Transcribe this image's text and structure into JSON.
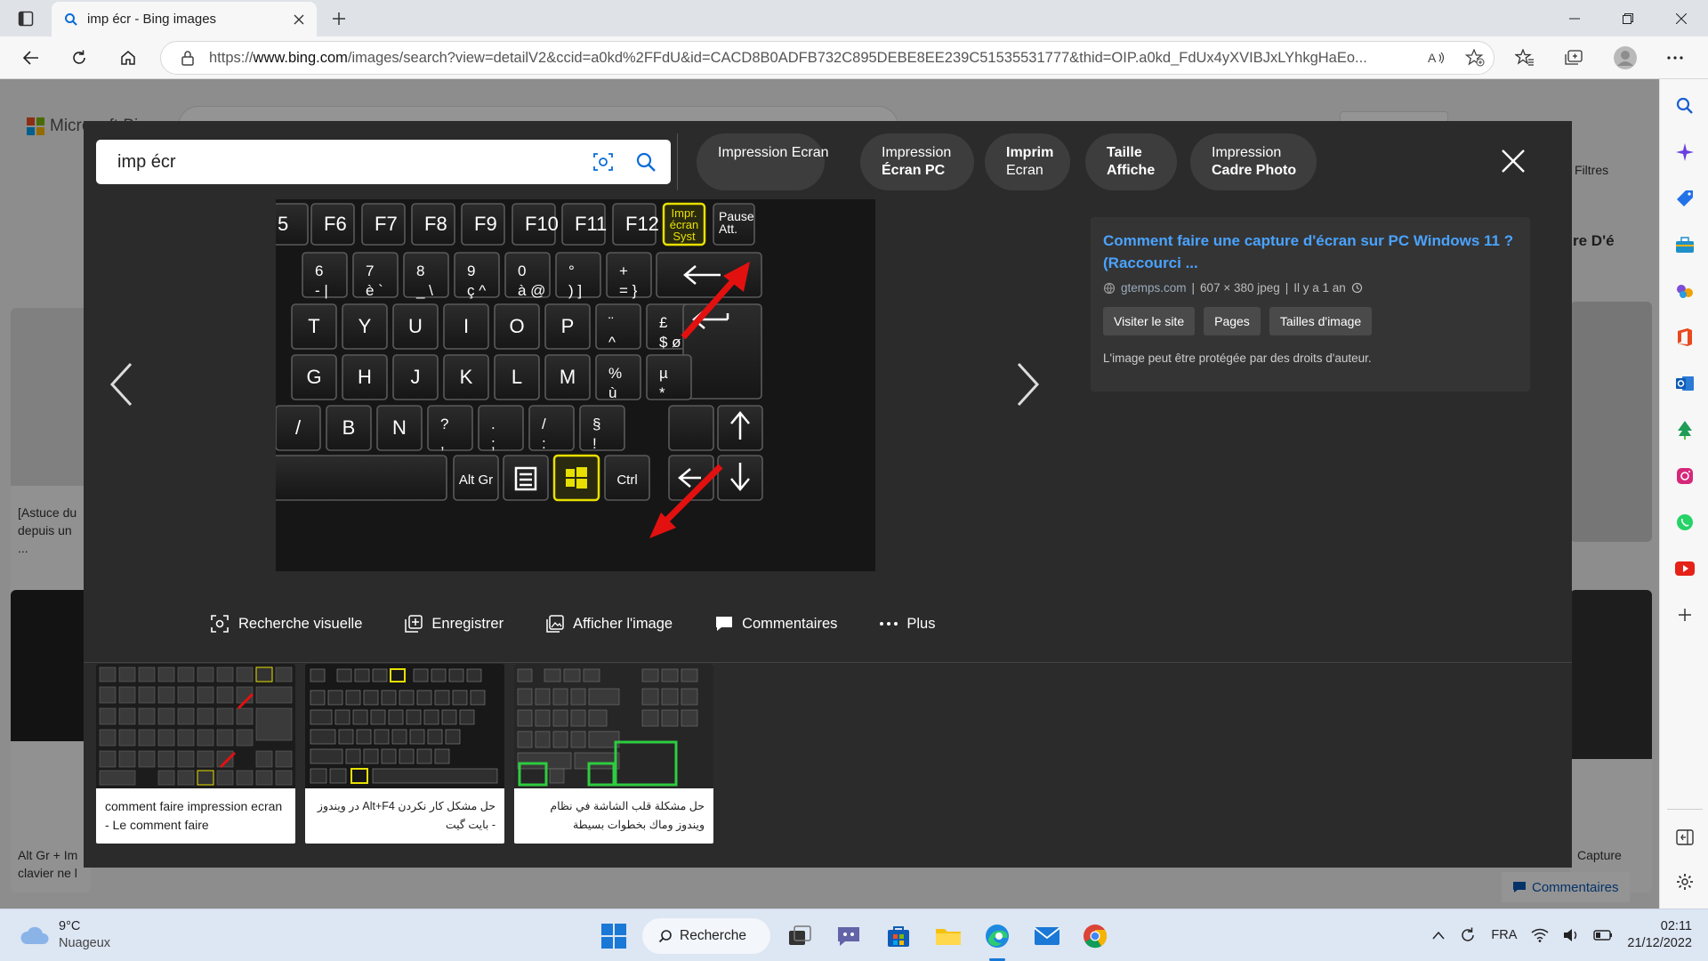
{
  "browser": {
    "tab_title": "imp écr - Bing images",
    "url_prefix": "https://",
    "url_domain": "www.bing.com",
    "url_rest": "/images/search?view=detailV2&ccid=a0kd%2FFdU&id=CACD8B0ADFB732C895DEBE8EE239C51535531777&thid=OIP.a0kd_FdUx4yXVIBJxLYhkgHaEo..."
  },
  "background": {
    "logo_text": "Microsoft Bing",
    "filter_label": "Filtres",
    "cards": [
      {
        "caption": "[Astuce du\ndepuis un ..."
      },
      {
        "caption": "Alt Gr + Im\nclavier ne l"
      },
      {
        "caption": "Capture"
      },
      {
        "caption": "re D'é"
      }
    ],
    "feedback_label": "Commentaires"
  },
  "overlay": {
    "search_query": "imp écr",
    "pills": [
      {
        "line1": "Impression Ecran",
        "line2": ""
      },
      {
        "line1": "Impression",
        "line2": "Écran PC"
      },
      {
        "line1": "Imprim",
        "line2": "Ecran"
      },
      {
        "line1": "Taille",
        "line2": "Affiche"
      },
      {
        "line1": "Impression",
        "line2": "Cadre Photo"
      }
    ],
    "info": {
      "title": "Comment faire une capture d'écran sur PC Windows 11 ? (Raccourci ...",
      "source": "gtemps.com",
      "dims": "607 × 380 jpeg",
      "age": "Il y a 1 an",
      "visit_button": "Visiter le site",
      "pages_button": "Pages",
      "sizes_button": "Tailles d'image",
      "copyright": "L'image peut être protégée par des droits d'auteur."
    },
    "actions": {
      "visual_search": "Recherche visuelle",
      "save": "Enregistrer",
      "view_image": "Afficher l'image",
      "comments": "Commentaires",
      "more": "Plus"
    },
    "related": [
      {
        "caption": "comment faire impression ecran - Le comment faire"
      },
      {
        "caption": "حل مشکل کار نکردن Alt+F4 در ویندوز - بایت گیت"
      },
      {
        "caption": "حل مشكلة قلب الشاشة في نظام ويندوز وماك بخطوات بسيطة"
      }
    ],
    "keyboard": {
      "row_f": [
        "5",
        "F6",
        "F7",
        "F8",
        "F9",
        "F10",
        "F11",
        "F12",
        "Impr. écran Syst",
        "Pause Att."
      ],
      "row_n": [
        "6\n-   |",
        "7\nè   `",
        "8\n_   \\",
        "9\nç   ^",
        "0\nà   @",
        "°\n)   ]",
        "+\n=   }"
      ],
      "row_t": [
        "T",
        "Y",
        "U",
        "I",
        "O",
        "P",
        "¨\n^",
        "£\n$   ø"
      ],
      "row_g": [
        "G",
        "H",
        "J",
        "K",
        "L",
        "M",
        "%\nù",
        "µ\n*"
      ],
      "row_b": [
        "/",
        "B",
        "N",
        "?\n,",
        ".\n;",
        "/\n:",
        "§\n!"
      ],
      "row_bottom": [
        "Alt Gr",
        "Ctrl"
      ]
    }
  },
  "taskbar": {
    "temp": "9°C",
    "weather": "Nuageux",
    "search_label": "Recherche",
    "lang": "FRA",
    "time": "02:11",
    "date": "21/12/2022"
  },
  "colors": {
    "overlay_bg": "#2b2b2b",
    "link_blue": "#4aa3ff",
    "highlight_yellow": "#e8e000",
    "arrow_red": "#e31010",
    "green_box": "#2ecc40"
  }
}
